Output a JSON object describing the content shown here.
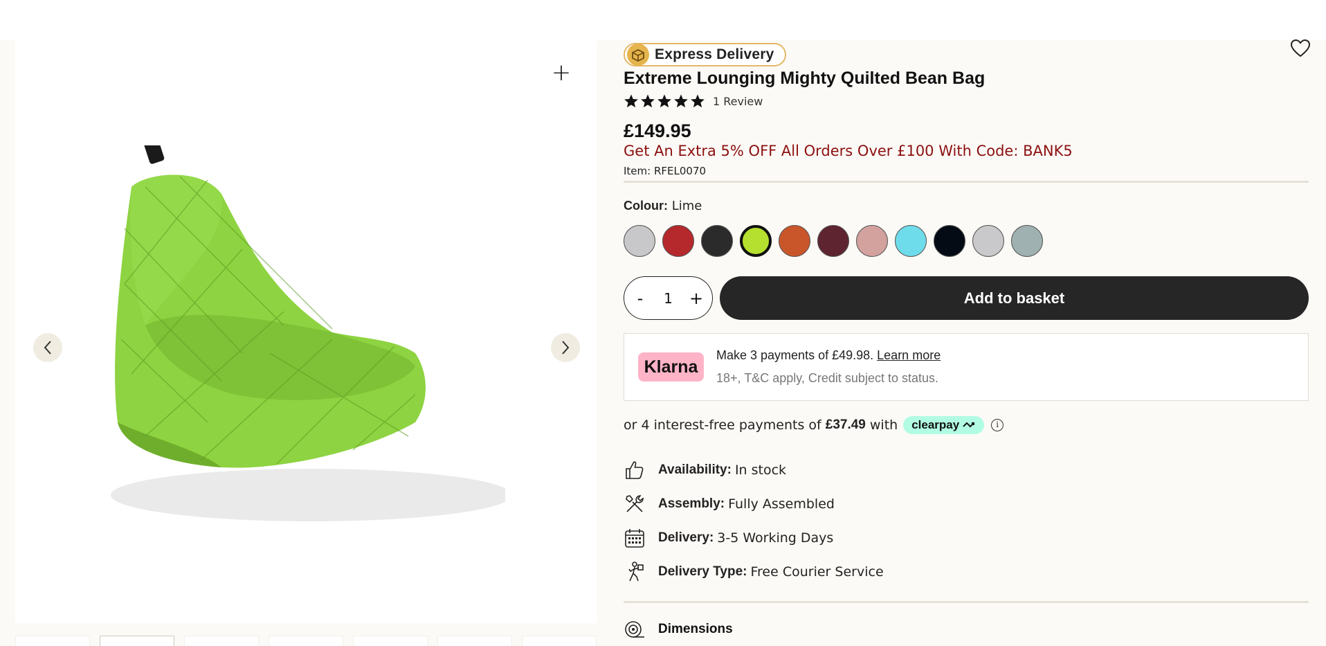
{
  "gallery": {
    "zoom_label": "+",
    "prev_icon": "chevron-left-icon",
    "next_icon": "chevron-right-icon",
    "thumb_count": 7
  },
  "badge": {
    "label": "Express Delivery",
    "icon": "delivery-box-icon"
  },
  "product": {
    "title": "Extreme Lounging Mighty Quilted Bean Bag",
    "rating": 5,
    "reviews": "1 Review",
    "price": "£149.95",
    "promo": "Get An Extra 5% OFF All Orders Over £100 With Code: BANK5",
    "item_code": "Item: RFEL0070"
  },
  "colour": {
    "label": "Colour:",
    "selected": "Lime",
    "swatches": [
      "#c8c8ca",
      "#b5282c",
      "#2b2b2b",
      "#b6e02f",
      "#c9562a",
      "#5e2430",
      "#d3a29e",
      "#6fdceb",
      "#050b14",
      "#c9c9cb",
      "#9fb1b1"
    ],
    "selected_index": 3
  },
  "basket": {
    "minus": "-",
    "quantity": "1",
    "plus": "+",
    "add_label": "Add to basket"
  },
  "klarna": {
    "logo": "Klarna",
    "text": "Make 3 payments of £49.98.",
    "learn_more": "Learn more",
    "sub": "18+, T&C apply, Credit subject to status."
  },
  "clearpay": {
    "prefix": "or 4 interest-free payments of",
    "amount": "£37.49",
    "with": "with",
    "brand": "clearpay",
    "info": "i"
  },
  "specs": {
    "availability": {
      "label": "Availability:",
      "value": "In stock",
      "icon": "thumbs-up-icon"
    },
    "assembly": {
      "label": "Assembly:",
      "value": "Fully Assembled",
      "icon": "tools-icon"
    },
    "delivery": {
      "label": "Delivery:",
      "value": "3-5 Working Days",
      "icon": "calendar-icon"
    },
    "delivery_type": {
      "label": "Delivery Type:",
      "value": "Free Courier Service",
      "icon": "courier-icon"
    }
  },
  "dimensions": {
    "label": "Dimensions",
    "icon": "tape-measure-icon"
  },
  "colors": {
    "accent": "#262626",
    "promo": "#8b1010",
    "express_border": "#e3b766"
  }
}
